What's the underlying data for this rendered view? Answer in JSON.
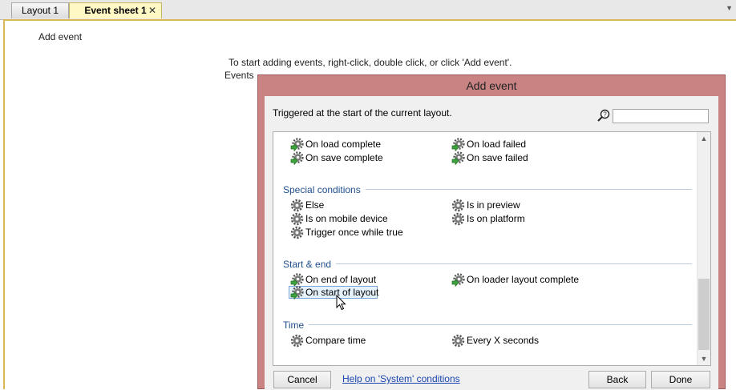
{
  "tabs": [
    {
      "label": "Layout 1"
    },
    {
      "label": "Event sheet 1",
      "close": "✕"
    }
  ],
  "sheet": {
    "add_event_label": "Add event",
    "hint_line1": "To start adding events, right-click, double click, or click 'Add event'.",
    "hint_line2": "Events a"
  },
  "dialog": {
    "title": "Add event",
    "description": "Triggered at the start of the current layout.",
    "search": {
      "value": "",
      "placeholder": ""
    },
    "sections": [
      {
        "heading": "",
        "items": [
          "On load complete",
          "On load failed",
          "On save complete",
          "On save failed"
        ]
      },
      {
        "heading": "Special conditions",
        "items": [
          "Else",
          "Is in preview",
          "Is on mobile device",
          "Is on platform",
          "Trigger once while true"
        ]
      },
      {
        "heading": "Start & end",
        "items": [
          "On end of layout",
          "On loader layout complete",
          "On start of layout"
        ]
      },
      {
        "heading": "Time",
        "items": [
          "Compare time",
          "Every X seconds"
        ]
      }
    ],
    "selected_item": "On start of layout",
    "buttons": {
      "cancel": "Cancel",
      "help": "Help on 'System' conditions",
      "back": "Back",
      "done": "Done"
    }
  },
  "colors": {
    "accent": "#d8b95a",
    "dialog_frame": "#c98383",
    "category": "#1f4e8c"
  }
}
